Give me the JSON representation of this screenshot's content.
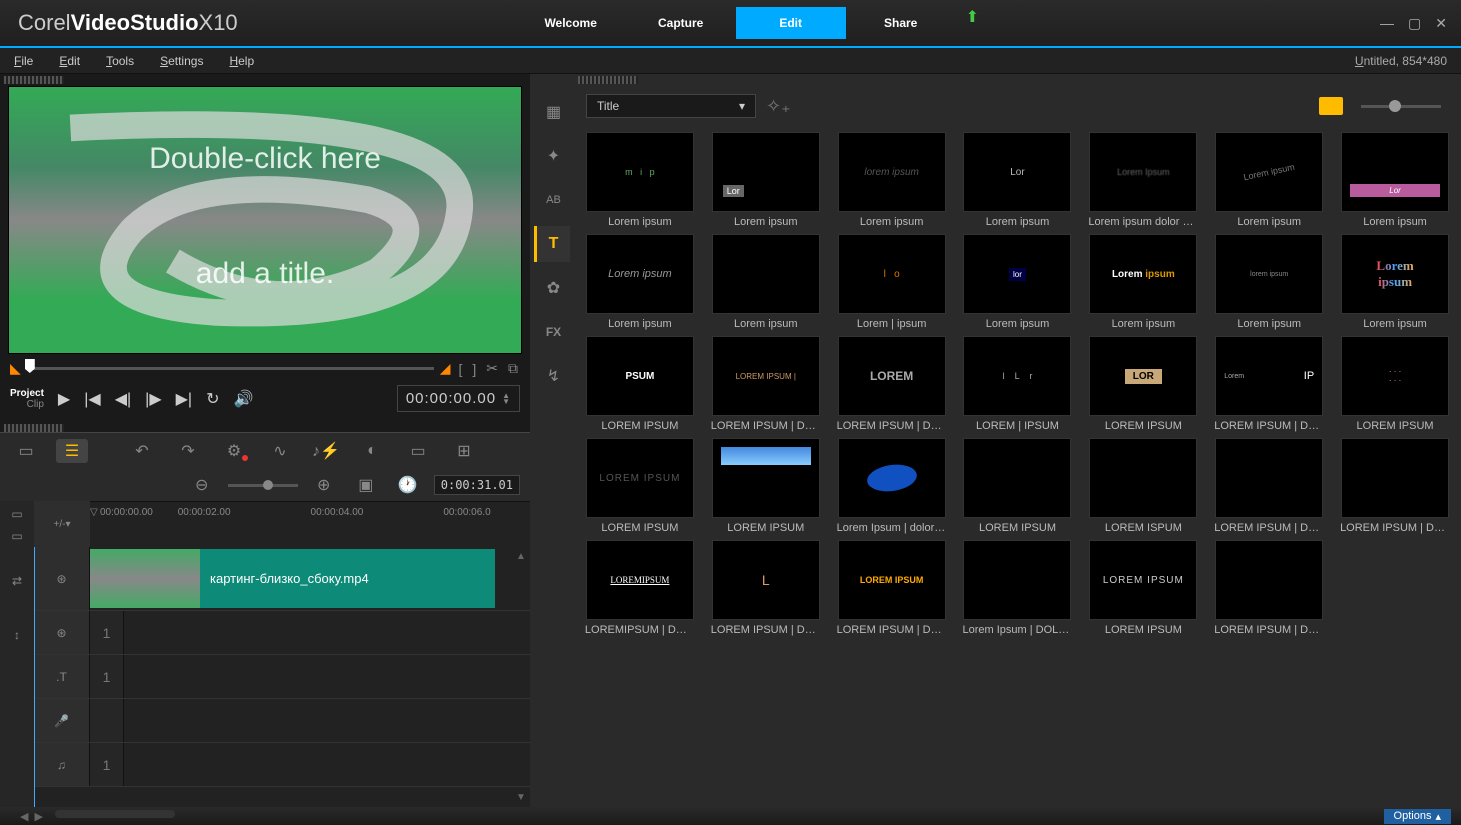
{
  "app": {
    "brand_pre": "Corel",
    "brand_mid": "VideoStudio",
    "brand_suf": "X10"
  },
  "tabs": {
    "welcome": "Welcome",
    "capture": "Capture",
    "edit": "Edit",
    "share": "Share"
  },
  "doc_title": "Untitled, 854*480",
  "menu": {
    "file": "File",
    "edit": "Edit",
    "tools": "Tools",
    "settings": "Settings",
    "help": "Help"
  },
  "preview": {
    "line1": "Double-click here",
    "line2": "add a title."
  },
  "play": {
    "mode1": "Project",
    "mode2": "Clip",
    "timecode": "00:00:00.00"
  },
  "timeline": {
    "zoom_time": "0:00:31.01",
    "ruler": [
      "00:00:00.00",
      "00:00:02.00",
      "00:00:04.00",
      "00:00:06.0"
    ],
    "clip_name": "картинг-близко_сбоку.mp4",
    "add_menu": "+/-"
  },
  "library": {
    "category": "Title",
    "items": [
      {
        "label": "Lorem ipsum",
        "style": "dots"
      },
      {
        "label": "Lorem ipsum",
        "style": "lorbar"
      },
      {
        "label": "Lorem ipsum",
        "style": "faint",
        "text": "lorem ipsum"
      },
      {
        "label": "Lorem ipsum",
        "style": "plain",
        "text": "Lor"
      },
      {
        "label": "Lorem ipsum dolor sit a…",
        "style": "blur",
        "text": "Lorem Ipsum"
      },
      {
        "label": "Lorem ipsum",
        "style": "diag"
      },
      {
        "label": "Lorem ipsum",
        "style": "pink",
        "text": "Lor"
      },
      {
        "label": "Lorem ipsum",
        "style": "italic",
        "text": "Lorem ipsum"
      },
      {
        "label": "Lorem ipsum",
        "style": "empty"
      },
      {
        "label": "Lorem | ipsum",
        "style": "orange-dots"
      },
      {
        "label": "Lorem ipsum",
        "style": "bluebox",
        "text": "lor"
      },
      {
        "label": "Lorem ipsum",
        "style": "bold-two",
        "text": "Lorem ipsum"
      },
      {
        "label": "Lorem ipsum",
        "style": "tiny",
        "text": "lorem ipsum"
      },
      {
        "label": "Lorem ipsum",
        "style": "rainbow",
        "text": "Lorem ipsum"
      },
      {
        "label": "LOREM IPSUM",
        "style": "white-small",
        "text": "PSUM"
      },
      {
        "label": "LOREM IPSUM | DOL…",
        "style": "orange-under",
        "text": "LOREM IPSUM |"
      },
      {
        "label": "LOREM IPSUM | DOL…",
        "style": "shadow",
        "text": "LOREM"
      },
      {
        "label": "LOREM | IPSUM",
        "style": "split"
      },
      {
        "label": "LOREM IPSUM",
        "style": "tan",
        "text": "LOR"
      },
      {
        "label": "LOREM IPSUM | DOL…",
        "style": "side",
        "text": "IP"
      },
      {
        "label": "LOREM IPSUM",
        "style": "sparkle"
      },
      {
        "label": "LOREM IPSUM",
        "style": "outline",
        "text": "LOREM IPSUM"
      },
      {
        "label": "LOREM IPSUM",
        "style": "sky"
      },
      {
        "label": "Lorem Ipsum |  dolor sit …",
        "style": "oval"
      },
      {
        "label": "LOREM IPSUM",
        "style": "empty"
      },
      {
        "label": "LOREM ISPUM",
        "style": "empty"
      },
      {
        "label": "LOREM IPSUM | DOL…",
        "style": "empty"
      },
      {
        "label": "LOREM IPSUM | DOL…",
        "style": "empty"
      },
      {
        "label": "LOREMIPSUM | DOLO…",
        "style": "serif",
        "text": "LOREMIPSUM"
      },
      {
        "label": "LOREM IPSUM | DOL…",
        "style": "l-only",
        "text": "L"
      },
      {
        "label": "LOREM IPSUM | DOL…",
        "style": "gold",
        "text": "LOREM IPSUM"
      },
      {
        "label": "Lorem Ipsum | DOLOR …",
        "style": "empty"
      },
      {
        "label": "LOREM IPSUM",
        "style": "caps",
        "text": "LOREM IPSUM"
      },
      {
        "label": "LOREM IPSUM | DOL…",
        "style": "empty"
      }
    ]
  },
  "footer": {
    "options": "Options"
  }
}
